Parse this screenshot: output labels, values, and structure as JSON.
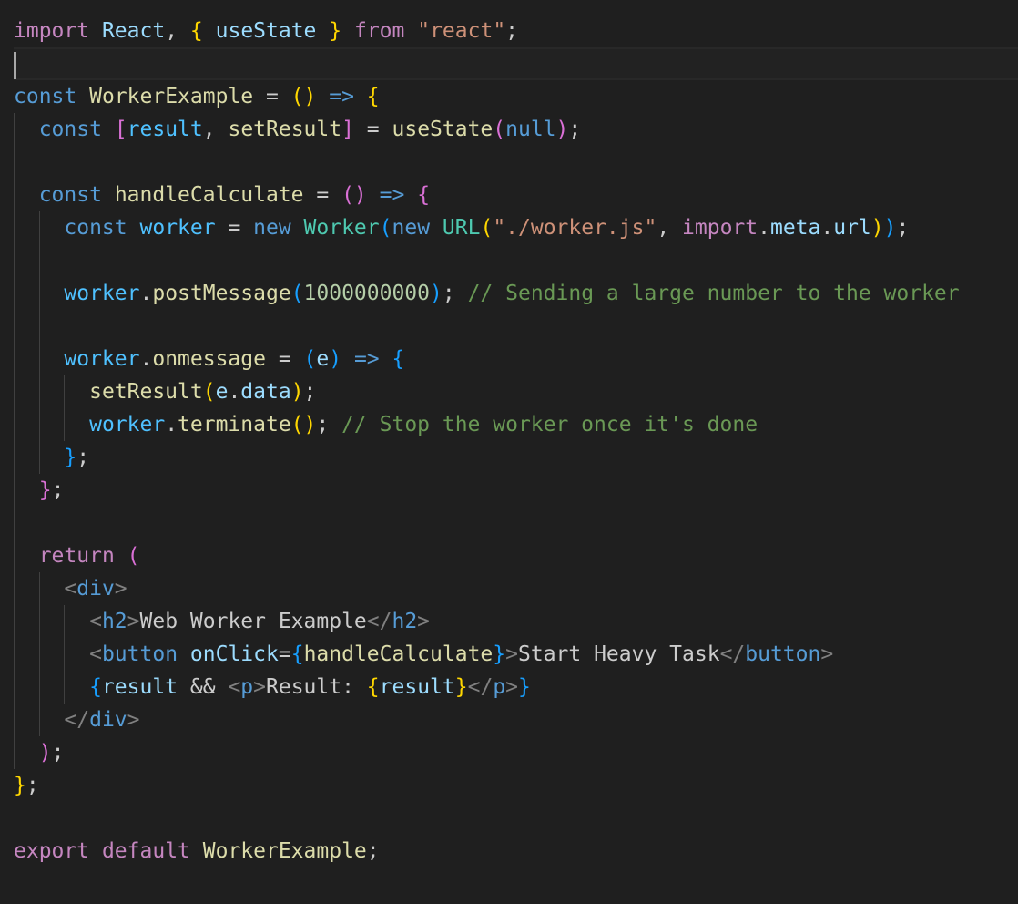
{
  "editor": {
    "theme_colors": {
      "background": "#1f1f1f",
      "keyword_purple": "#c586c0",
      "keyword_blue": "#569cd6",
      "variable": "#9cdcfe",
      "constant": "#4fc1ff",
      "function": "#dcdcaa",
      "class": "#4ec9b0",
      "string": "#ce9178",
      "number": "#b5cea8",
      "comment": "#6a9955",
      "text": "#cccccc",
      "tag_bracket": "#808080",
      "bracket_gold": "#ffd700",
      "bracket_pink": "#da70d6",
      "bracket_blue": "#179fff"
    },
    "lines": [
      {
        "tokens": [
          {
            "t": "import",
            "c": "#c586c0"
          },
          {
            "t": " ",
            "c": "#cccccc"
          },
          {
            "t": "React",
            "c": "#9cdcfe"
          },
          {
            "t": ", ",
            "c": "#cccccc"
          },
          {
            "t": "{",
            "c": "#ffd700"
          },
          {
            "t": " ",
            "c": "#cccccc"
          },
          {
            "t": "useState",
            "c": "#9cdcfe"
          },
          {
            "t": " ",
            "c": "#cccccc"
          },
          {
            "t": "}",
            "c": "#ffd700"
          },
          {
            "t": " ",
            "c": "#cccccc"
          },
          {
            "t": "from",
            "c": "#c586c0"
          },
          {
            "t": " ",
            "c": "#cccccc"
          },
          {
            "t": "\"react\"",
            "c": "#ce9178"
          },
          {
            "t": ";",
            "c": "#cccccc"
          }
        ]
      },
      {
        "current": true,
        "tokens": []
      },
      {
        "tokens": [
          {
            "t": "const",
            "c": "#569cd6"
          },
          {
            "t": " ",
            "c": "#cccccc"
          },
          {
            "t": "WorkerExample",
            "c": "#dcdcaa"
          },
          {
            "t": " = ",
            "c": "#cccccc"
          },
          {
            "t": "()",
            "c": "#ffd700"
          },
          {
            "t": " ",
            "c": "#cccccc"
          },
          {
            "t": "=>",
            "c": "#569cd6"
          },
          {
            "t": " ",
            "c": "#cccccc"
          },
          {
            "t": "{",
            "c": "#ffd700"
          }
        ]
      },
      {
        "guides": [
          1
        ],
        "tokens": [
          {
            "t": "  ",
            "c": "#cccccc"
          },
          {
            "t": "const",
            "c": "#569cd6"
          },
          {
            "t": " ",
            "c": "#cccccc"
          },
          {
            "t": "[",
            "c": "#da70d6"
          },
          {
            "t": "result",
            "c": "#4fc1ff"
          },
          {
            "t": ", ",
            "c": "#cccccc"
          },
          {
            "t": "setResult",
            "c": "#dcdcaa"
          },
          {
            "t": "]",
            "c": "#da70d6"
          },
          {
            "t": " = ",
            "c": "#cccccc"
          },
          {
            "t": "useState",
            "c": "#dcdcaa"
          },
          {
            "t": "(",
            "c": "#da70d6"
          },
          {
            "t": "null",
            "c": "#569cd6"
          },
          {
            "t": ")",
            "c": "#da70d6"
          },
          {
            "t": ";",
            "c": "#cccccc"
          }
        ]
      },
      {
        "guides": [
          1
        ],
        "tokens": []
      },
      {
        "guides": [
          1
        ],
        "tokens": [
          {
            "t": "  ",
            "c": "#cccccc"
          },
          {
            "t": "const",
            "c": "#569cd6"
          },
          {
            "t": " ",
            "c": "#cccccc"
          },
          {
            "t": "handleCalculate",
            "c": "#dcdcaa"
          },
          {
            "t": " = ",
            "c": "#cccccc"
          },
          {
            "t": "()",
            "c": "#da70d6"
          },
          {
            "t": " ",
            "c": "#cccccc"
          },
          {
            "t": "=>",
            "c": "#569cd6"
          },
          {
            "t": " ",
            "c": "#cccccc"
          },
          {
            "t": "{",
            "c": "#da70d6"
          }
        ]
      },
      {
        "guides": [
          1,
          2
        ],
        "tokens": [
          {
            "t": "    ",
            "c": "#cccccc"
          },
          {
            "t": "const",
            "c": "#569cd6"
          },
          {
            "t": " ",
            "c": "#cccccc"
          },
          {
            "t": "worker",
            "c": "#4fc1ff"
          },
          {
            "t": " = ",
            "c": "#cccccc"
          },
          {
            "t": "new",
            "c": "#569cd6"
          },
          {
            "t": " ",
            "c": "#cccccc"
          },
          {
            "t": "Worker",
            "c": "#4ec9b0"
          },
          {
            "t": "(",
            "c": "#179fff"
          },
          {
            "t": "new",
            "c": "#569cd6"
          },
          {
            "t": " ",
            "c": "#cccccc"
          },
          {
            "t": "URL",
            "c": "#4ec9b0"
          },
          {
            "t": "(",
            "c": "#ffd700"
          },
          {
            "t": "\"./worker.js\"",
            "c": "#ce9178"
          },
          {
            "t": ", ",
            "c": "#cccccc"
          },
          {
            "t": "import",
            "c": "#c586c0"
          },
          {
            "t": ".",
            "c": "#cccccc"
          },
          {
            "t": "meta",
            "c": "#9cdcfe"
          },
          {
            "t": ".",
            "c": "#cccccc"
          },
          {
            "t": "url",
            "c": "#9cdcfe"
          },
          {
            "t": ")",
            "c": "#ffd700"
          },
          {
            "t": ")",
            "c": "#179fff"
          },
          {
            "t": ";",
            "c": "#cccccc"
          }
        ]
      },
      {
        "guides": [
          1,
          2
        ],
        "tokens": []
      },
      {
        "guides": [
          1,
          2
        ],
        "tokens": [
          {
            "t": "    ",
            "c": "#cccccc"
          },
          {
            "t": "worker",
            "c": "#4fc1ff"
          },
          {
            "t": ".",
            "c": "#cccccc"
          },
          {
            "t": "postMessage",
            "c": "#dcdcaa"
          },
          {
            "t": "(",
            "c": "#179fff"
          },
          {
            "t": "1000000000",
            "c": "#b5cea8"
          },
          {
            "t": ")",
            "c": "#179fff"
          },
          {
            "t": "; ",
            "c": "#cccccc"
          },
          {
            "t": "// Sending a large number to the worker",
            "c": "#6a9955"
          }
        ]
      },
      {
        "guides": [
          1,
          2
        ],
        "tokens": []
      },
      {
        "guides": [
          1,
          2
        ],
        "tokens": [
          {
            "t": "    ",
            "c": "#cccccc"
          },
          {
            "t": "worker",
            "c": "#4fc1ff"
          },
          {
            "t": ".",
            "c": "#cccccc"
          },
          {
            "t": "onmessage",
            "c": "#dcdcaa"
          },
          {
            "t": " = ",
            "c": "#cccccc"
          },
          {
            "t": "(",
            "c": "#179fff"
          },
          {
            "t": "e",
            "c": "#9cdcfe"
          },
          {
            "t": ")",
            "c": "#179fff"
          },
          {
            "t": " ",
            "c": "#cccccc"
          },
          {
            "t": "=>",
            "c": "#569cd6"
          },
          {
            "t": " ",
            "c": "#cccccc"
          },
          {
            "t": "{",
            "c": "#179fff"
          }
        ]
      },
      {
        "guides": [
          1,
          2,
          3
        ],
        "tokens": [
          {
            "t": "      ",
            "c": "#cccccc"
          },
          {
            "t": "setResult",
            "c": "#dcdcaa"
          },
          {
            "t": "(",
            "c": "#ffd700"
          },
          {
            "t": "e",
            "c": "#9cdcfe"
          },
          {
            "t": ".",
            "c": "#cccccc"
          },
          {
            "t": "data",
            "c": "#9cdcfe"
          },
          {
            "t": ")",
            "c": "#ffd700"
          },
          {
            "t": ";",
            "c": "#cccccc"
          }
        ]
      },
      {
        "guides": [
          1,
          2,
          3
        ],
        "tokens": [
          {
            "t": "      ",
            "c": "#cccccc"
          },
          {
            "t": "worker",
            "c": "#4fc1ff"
          },
          {
            "t": ".",
            "c": "#cccccc"
          },
          {
            "t": "terminate",
            "c": "#dcdcaa"
          },
          {
            "t": "()",
            "c": "#ffd700"
          },
          {
            "t": "; ",
            "c": "#cccccc"
          },
          {
            "t": "// Stop the worker once it's done",
            "c": "#6a9955"
          }
        ]
      },
      {
        "guides": [
          1,
          2
        ],
        "tokens": [
          {
            "t": "    ",
            "c": "#cccccc"
          },
          {
            "t": "}",
            "c": "#179fff"
          },
          {
            "t": ";",
            "c": "#cccccc"
          }
        ]
      },
      {
        "guides": [
          1
        ],
        "tokens": [
          {
            "t": "  ",
            "c": "#cccccc"
          },
          {
            "t": "}",
            "c": "#da70d6"
          },
          {
            "t": ";",
            "c": "#cccccc"
          }
        ]
      },
      {
        "guides": [
          1
        ],
        "tokens": []
      },
      {
        "guides": [
          1
        ],
        "tokens": [
          {
            "t": "  ",
            "c": "#cccccc"
          },
          {
            "t": "return",
            "c": "#c586c0"
          },
          {
            "t": " ",
            "c": "#cccccc"
          },
          {
            "t": "(",
            "c": "#da70d6"
          }
        ]
      },
      {
        "guides": [
          1,
          2
        ],
        "tokens": [
          {
            "t": "    ",
            "c": "#cccccc"
          },
          {
            "t": "<",
            "c": "#808080"
          },
          {
            "t": "div",
            "c": "#569cd6"
          },
          {
            "t": ">",
            "c": "#808080"
          }
        ]
      },
      {
        "guides": [
          1,
          2,
          3
        ],
        "tokens": [
          {
            "t": "      ",
            "c": "#cccccc"
          },
          {
            "t": "<",
            "c": "#808080"
          },
          {
            "t": "h2",
            "c": "#569cd6"
          },
          {
            "t": ">",
            "c": "#808080"
          },
          {
            "t": "Web Worker Example",
            "c": "#cccccc"
          },
          {
            "t": "</",
            "c": "#808080"
          },
          {
            "t": "h2",
            "c": "#569cd6"
          },
          {
            "t": ">",
            "c": "#808080"
          }
        ]
      },
      {
        "guides": [
          1,
          2,
          3
        ],
        "tokens": [
          {
            "t": "      ",
            "c": "#cccccc"
          },
          {
            "t": "<",
            "c": "#808080"
          },
          {
            "t": "button",
            "c": "#569cd6"
          },
          {
            "t": " ",
            "c": "#cccccc"
          },
          {
            "t": "onClick",
            "c": "#9cdcfe"
          },
          {
            "t": "=",
            "c": "#cccccc"
          },
          {
            "t": "{",
            "c": "#179fff"
          },
          {
            "t": "handleCalculate",
            "c": "#dcdcaa"
          },
          {
            "t": "}",
            "c": "#179fff"
          },
          {
            "t": ">",
            "c": "#808080"
          },
          {
            "t": "Start Heavy Task",
            "c": "#cccccc"
          },
          {
            "t": "</",
            "c": "#808080"
          },
          {
            "t": "button",
            "c": "#569cd6"
          },
          {
            "t": ">",
            "c": "#808080"
          }
        ]
      },
      {
        "guides": [
          1,
          2,
          3
        ],
        "tokens": [
          {
            "t": "      ",
            "c": "#cccccc"
          },
          {
            "t": "{",
            "c": "#179fff"
          },
          {
            "t": "result",
            "c": "#9cdcfe"
          },
          {
            "t": " && ",
            "c": "#cccccc"
          },
          {
            "t": "<",
            "c": "#808080"
          },
          {
            "t": "p",
            "c": "#569cd6"
          },
          {
            "t": ">",
            "c": "#808080"
          },
          {
            "t": "Result: ",
            "c": "#cccccc"
          },
          {
            "t": "{",
            "c": "#ffd700"
          },
          {
            "t": "result",
            "c": "#9cdcfe"
          },
          {
            "t": "}",
            "c": "#ffd700"
          },
          {
            "t": "</",
            "c": "#808080"
          },
          {
            "t": "p",
            "c": "#569cd6"
          },
          {
            "t": ">",
            "c": "#808080"
          },
          {
            "t": "}",
            "c": "#179fff"
          }
        ]
      },
      {
        "guides": [
          1,
          2
        ],
        "tokens": [
          {
            "t": "    ",
            "c": "#cccccc"
          },
          {
            "t": "</",
            "c": "#808080"
          },
          {
            "t": "div",
            "c": "#569cd6"
          },
          {
            "t": ">",
            "c": "#808080"
          }
        ]
      },
      {
        "guides": [
          1
        ],
        "tokens": [
          {
            "t": "  ",
            "c": "#cccccc"
          },
          {
            "t": ")",
            "c": "#da70d6"
          },
          {
            "t": ";",
            "c": "#cccccc"
          }
        ]
      },
      {
        "tokens": [
          {
            "t": "}",
            "c": "#ffd700"
          },
          {
            "t": ";",
            "c": "#cccccc"
          }
        ]
      },
      {
        "tokens": []
      },
      {
        "tokens": [
          {
            "t": "export",
            "c": "#c586c0"
          },
          {
            "t": " ",
            "c": "#cccccc"
          },
          {
            "t": "default",
            "c": "#c586c0"
          },
          {
            "t": " ",
            "c": "#cccccc"
          },
          {
            "t": "WorkerExample",
            "c": "#dcdcaa"
          },
          {
            "t": ";",
            "c": "#cccccc"
          }
        ]
      }
    ]
  }
}
